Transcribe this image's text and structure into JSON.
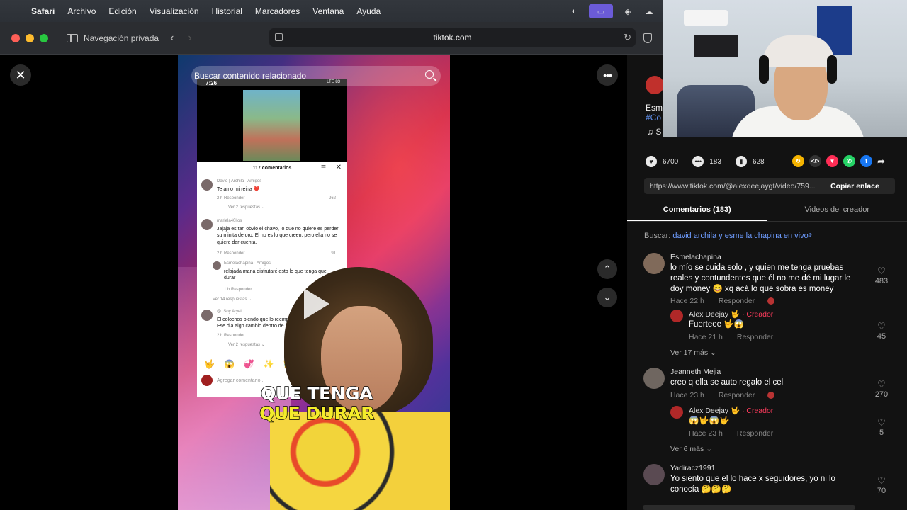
{
  "menubar": {
    "apple": "",
    "items": [
      "Safari",
      "Archivo",
      "Edición",
      "Visualización",
      "Historial",
      "Marcadores",
      "Ventana",
      "Ayuda"
    ]
  },
  "toolbar": {
    "private_label": "Navegación privada",
    "back": "‹",
    "forward": "›",
    "url": "tiktok.com",
    "reload": "↻"
  },
  "player": {
    "close": "✕",
    "more": "•••",
    "up": "⌃",
    "down": "⌄",
    "search_placeholder": "Buscar contenido relacionado",
    "caption_line1": "QUE TENGA",
    "caption_line2": "QUE DURAR"
  },
  "phone": {
    "time": "7:26",
    "status": "LTE 83",
    "sheet_title": "117 comentarios",
    "close": "✕",
    "comments": [
      {
        "name": "David | Archila · Amigos",
        "text": "Te amo mi reina ❤️",
        "meta": "2 h     Responder",
        "likes": "262",
        "more": "Ver 2 respuestas ⌄"
      },
      {
        "name": "mariela40lios",
        "text": "Jajaja es tan obvio el chavo, lo que no quiere es perder su minita de oro. El no es lo que creen, pero ella no se quiere dar cuenta.",
        "meta": "2 h     Responder",
        "likes": "91",
        "more": ""
      },
      {
        "name": "Esmelachapina · Amigos",
        "text": "relajada mana disfrutaré esto lo que tenga que durar",
        "meta": "1 h     Responder",
        "likes": "",
        "more": "Ver 14 respuestas ⌄"
      },
      {
        "name": "@ .Soy Aryel",
        "text": "El colochos biendo que lo reemp Ese dia algo cambio dentro de",
        "meta": "2 h     Responder",
        "likes": "",
        "more": "Ver 2 respuestas ⌄"
      }
    ],
    "emojis": [
      "🤟",
      "😱",
      "💞",
      "✨",
      "👑"
    ],
    "add_comment": "Agregar comentario..."
  },
  "panel": {
    "desc_a": "Esme",
    "desc_b": "#Co",
    "desc_c": "♫ S",
    "likes": "6700",
    "comments_count": "183",
    "saves": "628",
    "share_colors": [
      "#f5b400",
      "#333333",
      "#ff2d55",
      "#25d366",
      "#1877f2"
    ],
    "share_icons": [
      "↻",
      "</>",
      "▼",
      "✆",
      "f"
    ],
    "share_arrow": "➦",
    "link": "https://www.tiktok.com/@alexdeejaygt/video/759...",
    "copy_label": "Copiar enlace",
    "tabs": [
      "Comentarios (183)",
      "Videos del creador"
    ],
    "buscar_label": "Buscar:",
    "buscar_query": "david archila y esme la chapina en vivo",
    "comments": [
      {
        "name": "Esmelachapina",
        "text": "lo mío se cuida solo , y quien me tenga pruebas reales y contundentes que él no me dé mi lugar le doy money 😄 xq acá lo que sobra es money",
        "time": "Hace 22 h",
        "reply": "Responder",
        "likes": "483"
      },
      {
        "name": "Alex Deejay 🤟",
        "creator": "· Creador",
        "text": "Fuerteee 🤟😱",
        "time": "Hace 21 h",
        "reply": "Responder",
        "likes": "45"
      },
      {
        "more": "Ver 17 más ⌄"
      },
      {
        "name": "Jeanneth Mejia",
        "text": "creo q ella se auto regalo el cel",
        "time": "Hace 23 h",
        "reply": "Responder",
        "likes": "270"
      },
      {
        "name": "Alex Deejay 🤟",
        "creator": "· Creador",
        "text": "😱🤟😱🤟",
        "time": "Hace 23 h",
        "reply": "Responder",
        "likes": "5"
      },
      {
        "more": "Ver 6 más ⌄"
      },
      {
        "name": "Yadiracz1991",
        "text": "Yo siento que el lo hace x seguidores, yo ni lo conocía 🤔🤔🤔",
        "time": "",
        "reply": "",
        "likes": "70"
      }
    ]
  }
}
